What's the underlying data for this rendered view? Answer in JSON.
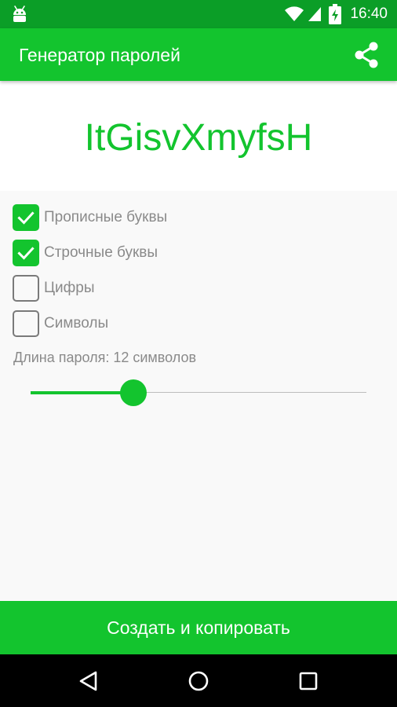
{
  "status_bar": {
    "time": "16:40",
    "icons": [
      "android-icon",
      "wifi-icon",
      "signal-icon",
      "battery-charging-icon"
    ]
  },
  "app_bar": {
    "title": "Генератор паролей",
    "share_icon": "share-icon"
  },
  "password": {
    "value": "ItGisvXmyfsH"
  },
  "options": [
    {
      "label": "Прописные буквы",
      "checked": true
    },
    {
      "label": "Строчные буквы",
      "checked": true
    },
    {
      "label": "Цифры",
      "checked": false
    },
    {
      "label": "Символы",
      "checked": false
    }
  ],
  "length": {
    "label": "Длина пароля: 12 символов",
    "value": 12,
    "fraction": 0.306
  },
  "create_button": {
    "label": "Создать и копировать"
  },
  "nav_bar": {
    "icons": [
      "back-icon",
      "home-icon",
      "recents-icon"
    ]
  },
  "colors": {
    "accent": "#13c42e",
    "status_bar": "#0b9e27",
    "text_secondary": "#8a8a8a"
  }
}
